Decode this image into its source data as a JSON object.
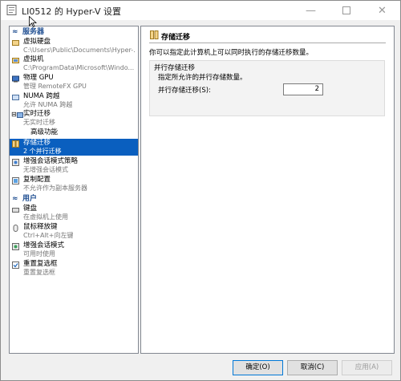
{
  "window": {
    "title": "LI0512 的 Hyper-V 设置",
    "min_glyph": "—",
    "close_glyph": "✕"
  },
  "sidebar": {
    "server_header": "服务器",
    "user_header": "用户",
    "server_items": [
      {
        "label": "虚拟硬盘",
        "sub": "C:\\Users\\Public\\Documents\\Hyper-...",
        "icon": "virtual-disk-icon"
      },
      {
        "label": "虚拟机",
        "sub": "C:\\ProgramData\\Microsoft\\Windo...",
        "icon": "virtual-machine-icon"
      },
      {
        "label": "物理 GPU",
        "sub": "管理 RemoteFX GPU",
        "icon": "gpu-icon"
      },
      {
        "label": "NUMA 跨越",
        "sub": "允许 NUMA 跨越",
        "icon": "numa-icon"
      },
      {
        "label": "实时迁移",
        "sub": "无实时迁移",
        "icon": "live-migration-icon"
      },
      {
        "label": "高级功能",
        "sub": "",
        "icon": ""
      },
      {
        "label": "存储迁移",
        "sub": "2 个并行迁移",
        "icon": "storage-migration-icon"
      },
      {
        "label": "增强会话模式策略",
        "sub": "无增强会话模式",
        "icon": "enhanced-session-policy-icon"
      },
      {
        "label": "复制配置",
        "sub": "不允许作为副本服务器",
        "icon": "replication-icon"
      }
    ],
    "user_items": [
      {
        "label": "键盘",
        "sub": "在虚拟机上使用",
        "icon": "keyboard-icon"
      },
      {
        "label": "鼠标释放键",
        "sub": "Ctrl+Alt+向左键",
        "icon": "mouse-icon"
      },
      {
        "label": "增强会话模式",
        "sub": "可用时使用",
        "icon": "enhanced-session-icon"
      },
      {
        "label": "重置复选框",
        "sub": "重置复选框",
        "icon": "reset-checkbox-icon"
      }
    ]
  },
  "panel": {
    "title": "存储迁移",
    "description": "你可以指定此计算机上可以同时执行的存储迁移数量。",
    "group_title": "并行存储迁移",
    "group_desc": "指定所允许的并行存储数量。",
    "field_label": "并行存储迁移(S):",
    "field_value": "2"
  },
  "buttons": {
    "ok": "确定(O)",
    "cancel": "取消(C)",
    "apply": "应用(A)"
  },
  "colors": {
    "selection": "#0a5fbf",
    "header_text": "#1f4e91"
  }
}
